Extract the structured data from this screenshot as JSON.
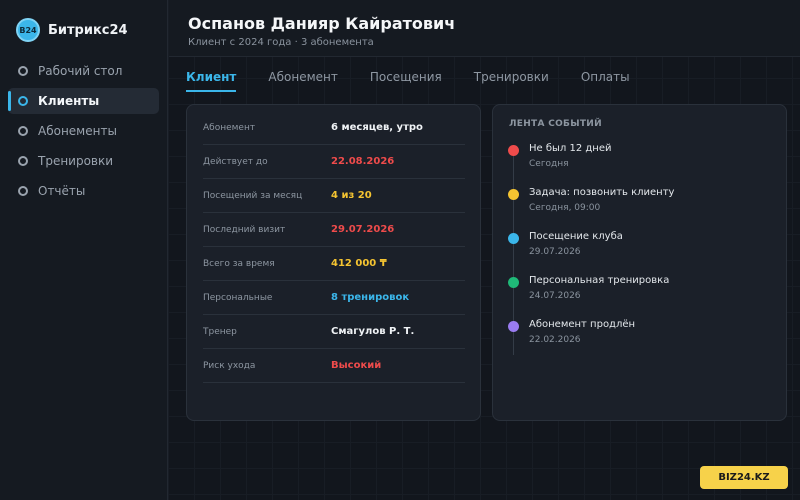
{
  "app": {
    "name": "Битрикс24",
    "logo_text": "B24"
  },
  "sidebar": {
    "items": [
      {
        "label": "Рабочий стол",
        "active": false
      },
      {
        "label": "Клиенты",
        "active": true
      },
      {
        "label": "Абонементы",
        "active": false
      },
      {
        "label": "Тренировки",
        "active": false
      },
      {
        "label": "Отчёты",
        "active": false
      }
    ]
  },
  "header": {
    "title": "Оспанов Данияр Кайратович",
    "subtitle": "Клиент с 2024 года · 3 абонемента"
  },
  "tabs": [
    {
      "label": "Клиент",
      "active": true
    },
    {
      "label": "Абонемент",
      "active": false
    },
    {
      "label": "Посещения",
      "active": false
    },
    {
      "label": "Тренировки",
      "active": false
    },
    {
      "label": "Оплаты",
      "active": false
    }
  ],
  "info": {
    "rows": [
      {
        "label": "Абонемент",
        "value": "6 месяцев, утро",
        "color": "#f0f3f6"
      },
      {
        "label": "Действует до",
        "value": "22.08.2026",
        "color": "#ef4b4b"
      },
      {
        "label": "Посещений за месяц",
        "value": "4 из 20",
        "color": "#f5c431"
      },
      {
        "label": "Последний визит",
        "value": "29.07.2026",
        "color": "#ef4b4b"
      },
      {
        "label": "Всего за время",
        "value": "412 000 ₸",
        "color": "#f5c431"
      },
      {
        "label": "Персональные",
        "value": "8 тренировок",
        "color": "#3bb6ea"
      },
      {
        "label": "Тренер",
        "value": "Смагулов Р. Т.",
        "color": "#f0f3f6"
      },
      {
        "label": "Риск ухода",
        "value": "Высокий",
        "color": "#ef4b4b"
      }
    ]
  },
  "feed": {
    "title": "ЛЕНТА СОБЫТИЙ",
    "items": [
      {
        "text": "Не был 12 дней",
        "time": "Сегодня",
        "color": "#ef4b4b"
      },
      {
        "text": "Задача: позвонить клиенту",
        "time": "Сегодня, 09:00",
        "color": "#f5c431"
      },
      {
        "text": "Посещение клуба",
        "time": "29.07.2026",
        "color": "#3bb6ea"
      },
      {
        "text": "Персональная тренировка",
        "time": "24.07.2026",
        "color": "#1fb978"
      },
      {
        "text": "Абонемент продлён",
        "time": "22.02.2026",
        "color": "#9a7cf0"
      }
    ]
  },
  "watermark": {
    "text": "BIZ24.KZ"
  }
}
